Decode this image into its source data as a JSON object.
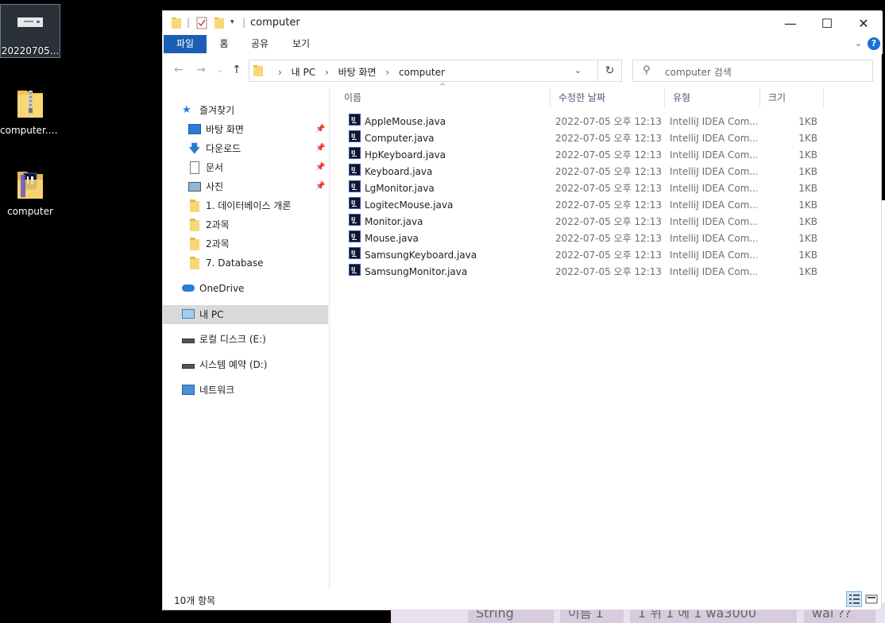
{
  "desktop": {
    "icons": [
      {
        "label": "20220705..."
      },
      {
        "label": "computer.zip"
      },
      {
        "label": "computer"
      }
    ]
  },
  "background_window": {
    "cells": [
      "String",
      "이름 1",
      "1 위 1 에 1 wa3000",
      "wal ??"
    ]
  },
  "window": {
    "title": "computer",
    "controls": {
      "minimize": "—",
      "maximize": "☐",
      "close": "✕"
    }
  },
  "ribbon": {
    "tabs": [
      "파일",
      "홈",
      "공유",
      "보기"
    ],
    "help": "?"
  },
  "address": {
    "crumbs": [
      "내 PC",
      "바탕 화면",
      "computer"
    ]
  },
  "search": {
    "placeholder": "computer 검색"
  },
  "navpane": {
    "quick_access": "즐겨찾기",
    "pinned": [
      "바탕 화면",
      "다운로드",
      "문서",
      "사진"
    ],
    "folders": [
      "1. 데이터베이스 개론",
      "2과목",
      "2과목",
      "7. Database"
    ],
    "onedrive": "OneDrive",
    "this_pc": "내 PC",
    "drives": [
      "로컬 디스크 (E:)",
      "시스템 예약 (D:)"
    ],
    "network": "네트워크"
  },
  "columns": {
    "name": "이름",
    "date": "수정한 날짜",
    "type": "유형",
    "size": "크기"
  },
  "files": [
    {
      "name": "AppleMouse.java",
      "date": "2022-07-05 오후 12:13",
      "type": "IntelliJ IDEA Com...",
      "size": "1KB"
    },
    {
      "name": "Computer.java",
      "date": "2022-07-05 오후 12:13",
      "type": "IntelliJ IDEA Com...",
      "size": "1KB"
    },
    {
      "name": "HpKeyboard.java",
      "date": "2022-07-05 오후 12:13",
      "type": "IntelliJ IDEA Com...",
      "size": "1KB"
    },
    {
      "name": "Keyboard.java",
      "date": "2022-07-05 오후 12:13",
      "type": "IntelliJ IDEA Com...",
      "size": "1KB"
    },
    {
      "name": "LgMonitor.java",
      "date": "2022-07-05 오후 12:13",
      "type": "IntelliJ IDEA Com...",
      "size": "1KB"
    },
    {
      "name": "LogitecMouse.java",
      "date": "2022-07-05 오후 12:13",
      "type": "IntelliJ IDEA Com...",
      "size": "1KB"
    },
    {
      "name": "Monitor.java",
      "date": "2022-07-05 오후 12:13",
      "type": "IntelliJ IDEA Com...",
      "size": "1KB"
    },
    {
      "name": "Mouse.java",
      "date": "2022-07-05 오후 12:13",
      "type": "IntelliJ IDEA Com...",
      "size": "1KB"
    },
    {
      "name": "SamsungKeyboard.java",
      "date": "2022-07-05 오후 12:13",
      "type": "IntelliJ IDEA Com...",
      "size": "1KB"
    },
    {
      "name": "SamsungMonitor.java",
      "date": "2022-07-05 오후 12:13",
      "type": "IntelliJ IDEA Com...",
      "size": "1KB"
    }
  ],
  "status": {
    "count": "10개 항목"
  },
  "colors": {
    "file_tab": "#1a5fb4",
    "selected_nav": "#d9d9d9",
    "folder": "#f8d775"
  }
}
